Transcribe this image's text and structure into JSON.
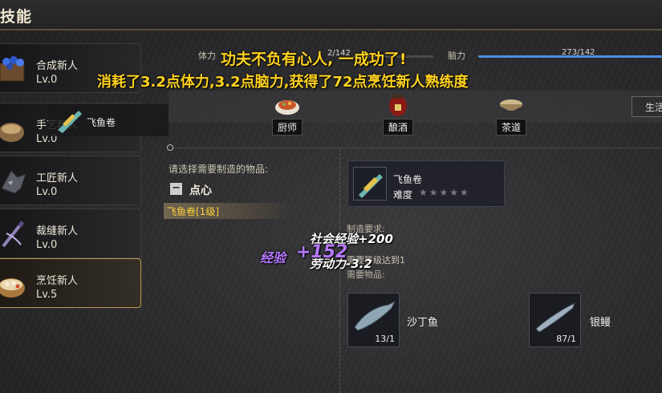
{
  "window": {
    "title": "技能"
  },
  "skills": [
    {
      "name": "合成新人",
      "level": "Lv.0"
    },
    {
      "name": "手艺新人",
      "level": "Lv.0"
    },
    {
      "name": "工匠新人",
      "level": "Lv.0"
    },
    {
      "name": "裁缝新人",
      "level": "Lv.0"
    },
    {
      "name": "烹饪新人",
      "level": "Lv.5"
    }
  ],
  "stats": {
    "stamina_label": "体力",
    "stamina_value": "2/142",
    "mind_label": "脑力",
    "mind_value": "273/142",
    "mind_fill_fraction": 1.0
  },
  "categories": [
    {
      "label": "厨师",
      "icon": "dish-icon"
    },
    {
      "label": "酿酒",
      "icon": "wine-jar-icon"
    },
    {
      "label": "茶道",
      "icon": "tea-bowl-icon"
    }
  ],
  "side_tab": {
    "label": "生活"
  },
  "recipe_panel": {
    "choose_label": "请选择需要制造的物品:",
    "group_toggle": "−",
    "group_label": "点心",
    "selected_recipe": "飞鱼卷[1级]"
  },
  "item": {
    "name": "飞鱼卷",
    "difficulty_label": "难度",
    "stars": "★★★★★",
    "star_rating": 0
  },
  "requirements": {
    "label": "制造要求:",
    "text": "需要等级达到1",
    "materials_label": "需要物品:",
    "materials": [
      {
        "name": "沙丁鱼",
        "count": "13/1"
      },
      {
        "name": "银鳗",
        "count": "87/1"
      }
    ]
  },
  "popup": {
    "line1": "功夫不负有心人, 一成功了!",
    "line2": "消耗了3.2点体力,3.2点脑力,获得了72点烹饪新人熟练度"
  },
  "floating": {
    "tooltip_item": "飞鱼卷",
    "social_exp": "社会经验+200",
    "labor": "劳动力-3.2",
    "exp_label": "经验",
    "exp_value": "+152"
  },
  "colors": {
    "gold": "#ffd21e",
    "bar_blue": "#4a8fe0",
    "exp_purple": "#b678ff"
  }
}
